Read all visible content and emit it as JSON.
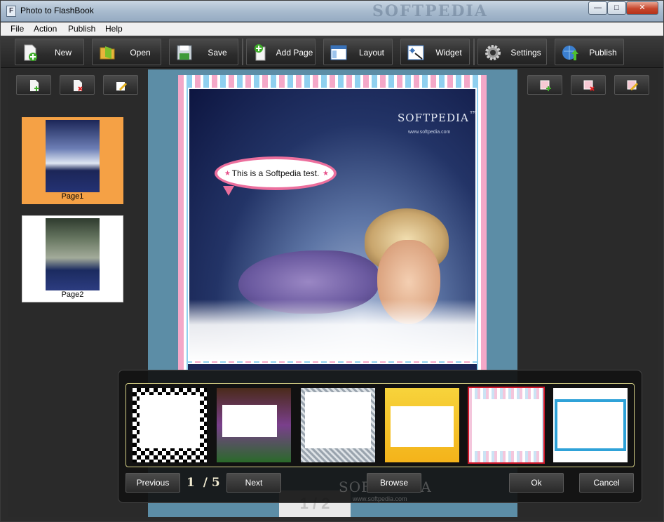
{
  "window": {
    "title": "Photo to FlashBook",
    "app_icon": "F",
    "watermark": "SOFTPEDIA",
    "controls": {
      "minimize": "—",
      "maximize": "□",
      "close": "✕"
    }
  },
  "menu": [
    "File",
    "Action",
    "Publish",
    "Help"
  ],
  "toolbar": {
    "new": "New",
    "open": "Open",
    "save": "Save",
    "add_page": "Add Page",
    "layout": "Layout",
    "widget": "Widget",
    "settings": "Settings",
    "publish": "Publish"
  },
  "pages": [
    {
      "label": "Page1",
      "selected": true
    },
    {
      "label": "Page2",
      "selected": false
    }
  ],
  "canvas": {
    "bubble_text": "This is a Softpedia test.",
    "logo": "SOFTPEDIA",
    "logo_tm": "™",
    "logo_url": "www.softpedia.com",
    "page_indicator_back": "1 / 2"
  },
  "frame_picker": {
    "frame_names": [
      "checkered-frame",
      "cartoon-frame",
      "dotted-gray-frame",
      "yellow-kids-frame",
      "pink-stripe-frame",
      "blue-wave-frame"
    ],
    "selected_index": 4,
    "previous": "Previous",
    "page_current": "1",
    "page_total": "/ 5",
    "next": "Next",
    "browse": "Browse",
    "ok": "Ok",
    "cancel": "Cancel",
    "watermark": "SOFTPEDIA",
    "watermark_url": "www.softpedia.com"
  },
  "colors": {
    "selected_thumb": "#f5a145",
    "canvas_bg": "#5c8da6",
    "selected_frame_border": "#d0192a"
  }
}
